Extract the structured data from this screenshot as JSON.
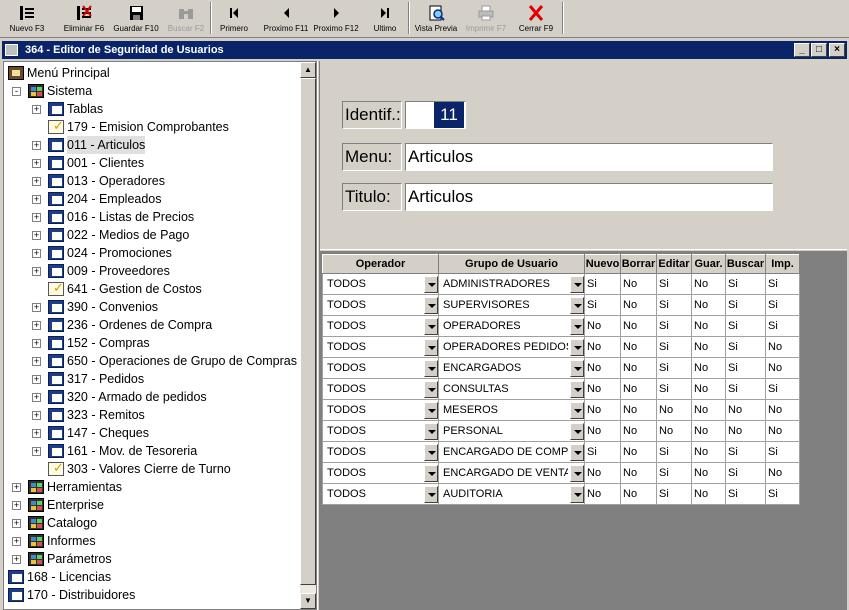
{
  "toolbar": {
    "buttons": [
      {
        "label": "Nuevo F3",
        "icon": "new-icon",
        "enabled": true
      },
      {
        "label": "Eliminar F6",
        "icon": "delete-icon",
        "enabled": true
      },
      {
        "label": "Guardar F10",
        "icon": "save-icon",
        "enabled": true
      },
      {
        "label": "Buscar F2",
        "icon": "binoculars-icon",
        "enabled": false
      },
      {
        "label": "Primero",
        "icon": "first-icon",
        "enabled": true
      },
      {
        "label": "Proximo F11",
        "icon": "prev-icon",
        "enabled": true
      },
      {
        "label": "Proximo F12",
        "icon": "next-icon",
        "enabled": true
      },
      {
        "label": "Ultimo",
        "icon": "last-icon",
        "enabled": true
      },
      {
        "label": "Vista Previa",
        "icon": "preview-icon",
        "enabled": true
      },
      {
        "label": "Imprimir F7",
        "icon": "print-icon",
        "enabled": false
      },
      {
        "label": "Cerrar F9",
        "icon": "close-x-icon",
        "enabled": true
      }
    ]
  },
  "window": {
    "title": "364 - Editor de Seguridad de Usuarios",
    "minimize": "_",
    "maximize": "□",
    "close": "×"
  },
  "tree": {
    "items": [
      {
        "label": "Menú Principal",
        "level": 0,
        "icon": "root",
        "expander": ""
      },
      {
        "label": "Sistema",
        "level": 1,
        "icon": "folder",
        "expander": "-"
      },
      {
        "label": "Tablas",
        "level": 2,
        "icon": "grid",
        "expander": "+"
      },
      {
        "label": "179 - Emision Comprobantes",
        "level": 2,
        "icon": "doc",
        "expander": ""
      },
      {
        "label": "011 - Articulos",
        "level": 2,
        "icon": "grid",
        "expander": "+",
        "selected": true
      },
      {
        "label": "001 - Clientes",
        "level": 2,
        "icon": "grid",
        "expander": "+"
      },
      {
        "label": "013 - Operadores",
        "level": 2,
        "icon": "grid",
        "expander": "+"
      },
      {
        "label": "204 - Empleados",
        "level": 2,
        "icon": "grid",
        "expander": "+"
      },
      {
        "label": "016 - Listas de Precios",
        "level": 2,
        "icon": "grid",
        "expander": "+"
      },
      {
        "label": "022 - Medios de Pago",
        "level": 2,
        "icon": "grid",
        "expander": "+"
      },
      {
        "label": "024 - Promociones",
        "level": 2,
        "icon": "grid",
        "expander": "+"
      },
      {
        "label": "009 - Proveedores",
        "level": 2,
        "icon": "grid",
        "expander": "+"
      },
      {
        "label": "641 - Gestion de Costos",
        "level": 2,
        "icon": "doc",
        "expander": ""
      },
      {
        "label": "390 - Convenios",
        "level": 2,
        "icon": "grid",
        "expander": "+"
      },
      {
        "label": "236 - Ordenes de Compra",
        "level": 2,
        "icon": "grid",
        "expander": "+"
      },
      {
        "label": "152 - Compras",
        "level": 2,
        "icon": "grid",
        "expander": "+"
      },
      {
        "label": "650 - Operaciones de Grupo de Compras",
        "level": 2,
        "icon": "grid",
        "expander": "+"
      },
      {
        "label": "317 - Pedidos",
        "level": 2,
        "icon": "grid",
        "expander": "+"
      },
      {
        "label": "320 - Armado de pedidos",
        "level": 2,
        "icon": "grid",
        "expander": "+"
      },
      {
        "label": "323 - Remitos",
        "level": 2,
        "icon": "grid",
        "expander": "+"
      },
      {
        "label": "147 - Cheques",
        "level": 2,
        "icon": "grid",
        "expander": "+"
      },
      {
        "label": "161 - Mov. de Tesoreria",
        "level": 2,
        "icon": "grid",
        "expander": "+"
      },
      {
        "label": "303 - Valores Cierre de Turno",
        "level": 2,
        "icon": "doc",
        "expander": ""
      },
      {
        "label": "Herramientas",
        "level": 1,
        "icon": "folder",
        "expander": "+"
      },
      {
        "label": "Enterprise",
        "level": 1,
        "icon": "folder",
        "expander": "+"
      },
      {
        "label": "Catalogo",
        "level": 1,
        "icon": "folder",
        "expander": "+"
      },
      {
        "label": "Informes",
        "level": 1,
        "icon": "folder",
        "expander": "+"
      },
      {
        "label": "Parámetros",
        "level": 1,
        "icon": "folder",
        "expander": "+"
      },
      {
        "label": "168 - Licencias",
        "level": 0,
        "icon": "grid",
        "expander": ""
      },
      {
        "label": "170 - Distribuidores",
        "level": 0,
        "icon": "grid",
        "expander": ""
      }
    ]
  },
  "form": {
    "ident_label": "Identif.:",
    "ident_value": "11",
    "menu_label": "Menu:",
    "menu_value": "Articulos",
    "titulo_label": "Titulo:",
    "titulo_value": "Articulos"
  },
  "grid": {
    "headers": [
      "Operador",
      "Grupo de Usuario",
      "Nuevo",
      "Borrar",
      "Editar",
      "Guar.",
      "Buscar",
      "Imp."
    ],
    "rows": [
      {
        "operador": "TODOS",
        "grupo": "ADMINISTRADORES",
        "perms": [
          "Si",
          "No",
          "Si",
          "No",
          "Si",
          "Si"
        ]
      },
      {
        "operador": "TODOS",
        "grupo": "SUPERVISORES",
        "perms": [
          "Si",
          "No",
          "Si",
          "No",
          "Si",
          "Si"
        ]
      },
      {
        "operador": "TODOS",
        "grupo": "OPERADORES",
        "perms": [
          "No",
          "No",
          "Si",
          "No",
          "Si",
          "Si"
        ]
      },
      {
        "operador": "TODOS",
        "grupo": "OPERADORES PEDIDOS",
        "perms": [
          "No",
          "No",
          "Si",
          "No",
          "Si",
          "No"
        ]
      },
      {
        "operador": "TODOS",
        "grupo": "ENCARGADOS",
        "perms": [
          "No",
          "No",
          "Si",
          "No",
          "Si",
          "No"
        ]
      },
      {
        "operador": "TODOS",
        "grupo": "CONSULTAS",
        "perms": [
          "No",
          "No",
          "Si",
          "No",
          "Si",
          "Si"
        ]
      },
      {
        "operador": "TODOS",
        "grupo": "MESEROS",
        "perms": [
          "No",
          "No",
          "No",
          "No",
          "No",
          "No"
        ]
      },
      {
        "operador": "TODOS",
        "grupo": "PERSONAL",
        "perms": [
          "No",
          "No",
          "No",
          "No",
          "No",
          "No"
        ]
      },
      {
        "operador": "TODOS",
        "grupo": "ENCARGADO DE COMPRAS",
        "perms": [
          "Si",
          "No",
          "Si",
          "No",
          "Si",
          "Si"
        ]
      },
      {
        "operador": "TODOS",
        "grupo": "ENCARGADO DE VENTAS",
        "perms": [
          "No",
          "No",
          "Si",
          "No",
          "Si",
          "No"
        ]
      },
      {
        "operador": "TODOS",
        "grupo": "AUDITORIA",
        "perms": [
          "No",
          "No",
          "Si",
          "No",
          "Si",
          "Si"
        ]
      }
    ]
  }
}
